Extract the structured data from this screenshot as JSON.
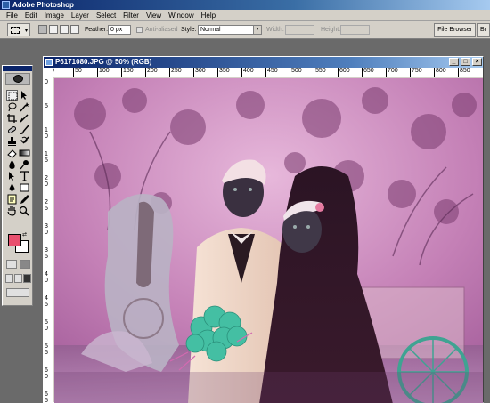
{
  "app": {
    "title": "Adobe Photoshop"
  },
  "menu": [
    "File",
    "Edit",
    "Image",
    "Layer",
    "Select",
    "Filter",
    "View",
    "Window",
    "Help"
  ],
  "options": {
    "feather_label": "Feather:",
    "feather_value": "0 px",
    "antialiased_label": "Anti-aliased",
    "style_label": "Style:",
    "style_value": "Normal",
    "width_label": "Width:",
    "height_label": "Height:",
    "palette_tabs": [
      "File Browser",
      "Br"
    ]
  },
  "document": {
    "title": "P6171080.JPG @ 50% (RGB)",
    "ruler_h": [
      "0",
      "50",
      "100",
      "150",
      "200",
      "250",
      "300",
      "350",
      "400",
      "450",
      "500",
      "550",
      "600",
      "650",
      "700",
      "750",
      "800",
      "850",
      "900"
    ],
    "ruler_v": [
      "0",
      "5",
      "1 0",
      "1 5",
      "2 0",
      "2 5",
      "3 0",
      "3 5",
      "4 0",
      "4 5",
      "5 0",
      "5 5",
      "6 0",
      "6 5"
    ]
  },
  "colors": {
    "foreground": "#e8506e",
    "background": "#ffffff",
    "title_active": "#0a246a",
    "chrome": "#d4d0c8"
  },
  "icons": {
    "tools": [
      "marquee-icon",
      "move-icon",
      "lasso-icon",
      "magic-wand-icon",
      "crop-icon",
      "slice-icon",
      "healing-brush-icon",
      "brush-icon",
      "clone-stamp-icon",
      "history-brush-icon",
      "eraser-icon",
      "gradient-icon",
      "blur-icon",
      "dodge-icon",
      "path-select-icon",
      "type-icon",
      "pen-icon",
      "shape-icon",
      "notes-icon",
      "eyedropper-icon",
      "hand-icon",
      "zoom-icon"
    ]
  }
}
